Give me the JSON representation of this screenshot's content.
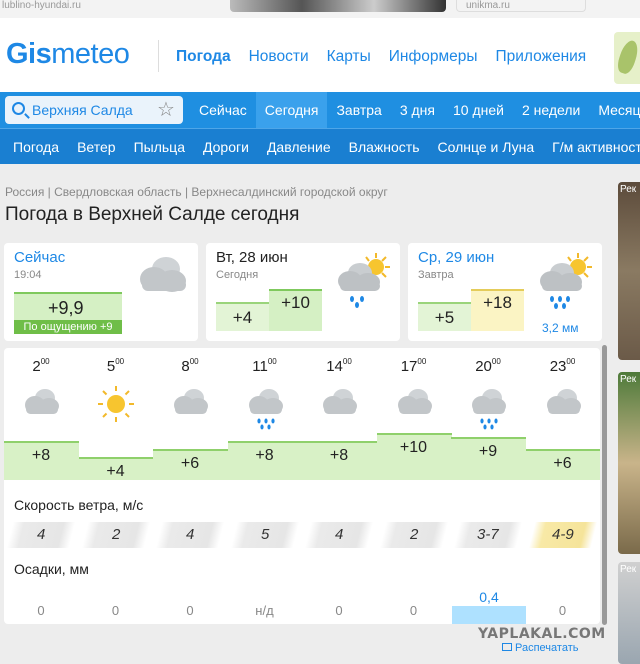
{
  "top_ads": {
    "left": "lublino-hyundai.ru",
    "right": "unikma.ru"
  },
  "logo": {
    "part1": "Gis",
    "part2": "meteo"
  },
  "main_nav": [
    "Погода",
    "Новости",
    "Карты",
    "Информеры",
    "Приложения"
  ],
  "search": {
    "value": "Верхняя Салда",
    "placeholder": "Верхняя Салда"
  },
  "tabs": [
    "Сейчас",
    "Сегодня",
    "Завтра",
    "3 дня",
    "10 дней",
    "2 недели",
    "Месяц"
  ],
  "subnav": [
    "Погода",
    "Ветер",
    "Пыльца",
    "Дороги",
    "Давление",
    "Влажность",
    "Солнце и Луна",
    "Г/м активност"
  ],
  "breadcrumb": "Россия | Свердловская область | Верхнесалдинский городской округ",
  "title": "Погода в Верхней Салде сегодня",
  "now_card": {
    "label": "Сейчас",
    "time": "19:04",
    "temp": "+9,9",
    "feels": "По ощущению +9",
    "icon": "cloudy-icon"
  },
  "today_card": {
    "label": "Вт, 28 июн",
    "sub": "Сегодня",
    "lo": "+4",
    "hi": "+10",
    "icon": "partly-cloudy-rain-icon"
  },
  "tomorrow_card": {
    "label": "Ср, 29 июн",
    "sub": "Завтра",
    "lo": "+5",
    "hi": "+18",
    "precip": "3,2 мм",
    "icon": "partly-cloudy-rain-icon"
  },
  "hours": [
    {
      "h": "2",
      "m": "00",
      "icon": "cloudy",
      "t": "+8",
      "level": 8,
      "wind": "4",
      "precip": "0"
    },
    {
      "h": "5",
      "m": "00",
      "icon": "sunny",
      "t": "+4",
      "level": 4,
      "wind": "2",
      "precip": "0"
    },
    {
      "h": "8",
      "m": "00",
      "icon": "cloudy",
      "t": "+6",
      "level": 6,
      "wind": "4",
      "precip": "0"
    },
    {
      "h": "11",
      "m": "00",
      "icon": "cloud-rain",
      "t": "+8",
      "level": 8,
      "wind": "5",
      "precip": "н/д"
    },
    {
      "h": "14",
      "m": "00",
      "icon": "cloudy",
      "t": "+8",
      "level": 8,
      "wind": "4",
      "precip": "0"
    },
    {
      "h": "17",
      "m": "00",
      "icon": "cloudy",
      "t": "+10",
      "level": 10,
      "wind": "2",
      "precip": "0"
    },
    {
      "h": "20",
      "m": "00",
      "icon": "cloud-rain",
      "t": "+9",
      "level": 9,
      "wind": "3-7",
      "precip": "0,4"
    },
    {
      "h": "23",
      "m": "00",
      "icon": "cloudy",
      "t": "+6",
      "level": 6,
      "wind": "4-9",
      "precip": "0"
    }
  ],
  "wind_label": "Скорость ветра, м/с",
  "precip_label": "Осадки, мм",
  "side_ad_label": "Рек",
  "watermark": "YAPLAKAL.COM",
  "print_label": "Распечатать",
  "colors": {
    "brand": "#1e88e5",
    "tab_bar": "#1f8fe1",
    "temp_green": "#d8f1c6",
    "warn_yellow": "#f5e49a"
  }
}
